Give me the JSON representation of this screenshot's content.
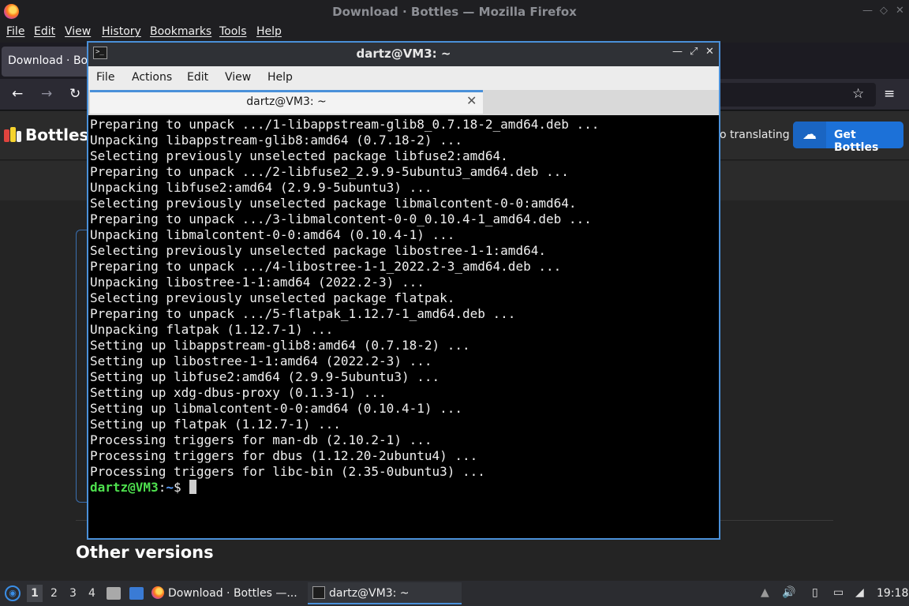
{
  "firefox": {
    "title": "Download · Bottles — Mozilla Firefox",
    "menu": [
      "File",
      "Edit",
      "View",
      "History",
      "Bookmarks",
      "Tools",
      "Help"
    ],
    "tab_label": "Download · Bottles",
    "colors": {
      "brand_blue": "#1c71d8"
    }
  },
  "page": {
    "brand": "Bottles",
    "translate_text": "o translating",
    "get_button": "Get Bottles",
    "section_heading": "Other versions"
  },
  "terminal": {
    "title": "dartz@VM3: ~",
    "menu": [
      "File",
      "Actions",
      "Edit",
      "View",
      "Help"
    ],
    "tab_label": "dartz@VM3: ~",
    "lines": [
      "Preparing to unpack .../1-libappstream-glib8_0.7.18-2_amd64.deb ...",
      "Unpacking libappstream-glib8:amd64 (0.7.18-2) ...",
      "Selecting previously unselected package libfuse2:amd64.",
      "Preparing to unpack .../2-libfuse2_2.9.9-5ubuntu3_amd64.deb ...",
      "Unpacking libfuse2:amd64 (2.9.9-5ubuntu3) ...",
      "Selecting previously unselected package libmalcontent-0-0:amd64.",
      "Preparing to unpack .../3-libmalcontent-0-0_0.10.4-1_amd64.deb ...",
      "Unpacking libmalcontent-0-0:amd64 (0.10.4-1) ...",
      "Selecting previously unselected package libostree-1-1:amd64.",
      "Preparing to unpack .../4-libostree-1-1_2022.2-3_amd64.deb ...",
      "Unpacking libostree-1-1:amd64 (2022.2-3) ...",
      "Selecting previously unselected package flatpak.",
      "Preparing to unpack .../5-flatpak_1.12.7-1_amd64.deb ...",
      "Unpacking flatpak (1.12.7-1) ...",
      "Setting up libappstream-glib8:amd64 (0.7.18-2) ...",
      "Setting up libostree-1-1:amd64 (2022.2-3) ...",
      "Setting up libfuse2:amd64 (2.9.9-5ubuntu3) ...",
      "Setting up xdg-dbus-proxy (0.1.3-1) ...",
      "Setting up libmalcontent-0-0:amd64 (0.10.4-1) ...",
      "Setting up flatpak (1.12.7-1) ...",
      "Processing triggers for man-db (2.10.2-1) ...",
      "Processing triggers for dbus (1.12.20-2ubuntu4) ...",
      "Processing triggers for libc-bin (2.35-0ubuntu3) ..."
    ],
    "prompt": {
      "user_host": "dartz@VM3",
      "separator": ":",
      "dir": "~",
      "symbol": "$"
    }
  },
  "taskbar": {
    "workspaces": [
      "1",
      "2",
      "3",
      "4"
    ],
    "tasks": [
      "Download · Bottles —...",
      "dartz@VM3: ~"
    ],
    "clock": "19:18"
  }
}
